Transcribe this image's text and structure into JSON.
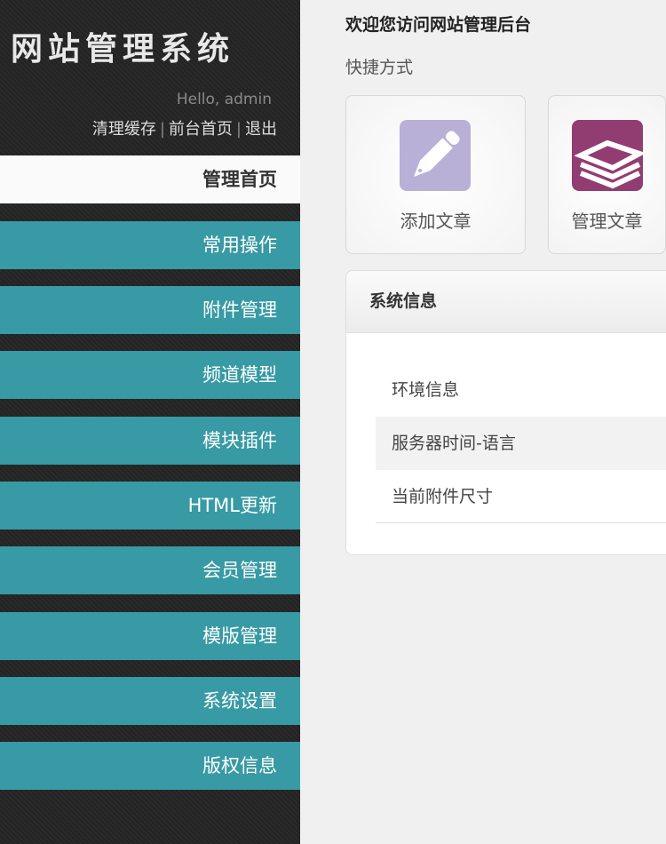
{
  "sidebar": {
    "logo": "网站管理系统",
    "hello": "Hello, admin",
    "links": [
      "清理缓存",
      "前台首页",
      "退出"
    ],
    "separator": "|",
    "menu": [
      "管理首页",
      "常用操作",
      "附件管理",
      "频道模型",
      "模块插件",
      "HTML更新",
      "会员管理",
      "模版管理",
      "系统设置",
      "版权信息"
    ]
  },
  "main": {
    "welcome": "欢迎您访问网站管理后台",
    "shortcut_title": "快捷方式",
    "shortcuts": [
      {
        "label": "添加文章",
        "icon": "pencil-icon",
        "color": "#b8b0d6"
      },
      {
        "label": "管理文章",
        "icon": "stack-icon",
        "color": "#923d72"
      }
    ],
    "panel": {
      "title": "系统信息",
      "rows": [
        "环境信息",
        "服务器时间-语言",
        "当前附件尺寸"
      ]
    }
  }
}
